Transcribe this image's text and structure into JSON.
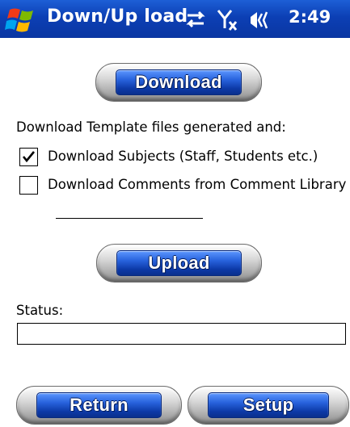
{
  "titlebar": {
    "app_title": "Down/Up load",
    "clock": "2:49",
    "icons": [
      "windows-start-icon",
      "sync-icon",
      "signal-off-icon",
      "speaker-icon"
    ]
  },
  "buttons": {
    "download": "Download",
    "upload": "Upload",
    "return": "Return",
    "setup": "Setup"
  },
  "download_section": {
    "instruction": "Download Template files generated and:",
    "options": [
      {
        "label": "Download Subjects (Staff, Students etc.)",
        "checked": true
      },
      {
        "label": "Download Comments from Comment Library",
        "checked": false
      }
    ]
  },
  "status": {
    "label": "Status:",
    "value": ""
  },
  "colors": {
    "titlebar": "#0c3fb4",
    "button_core": "#2762dc"
  }
}
